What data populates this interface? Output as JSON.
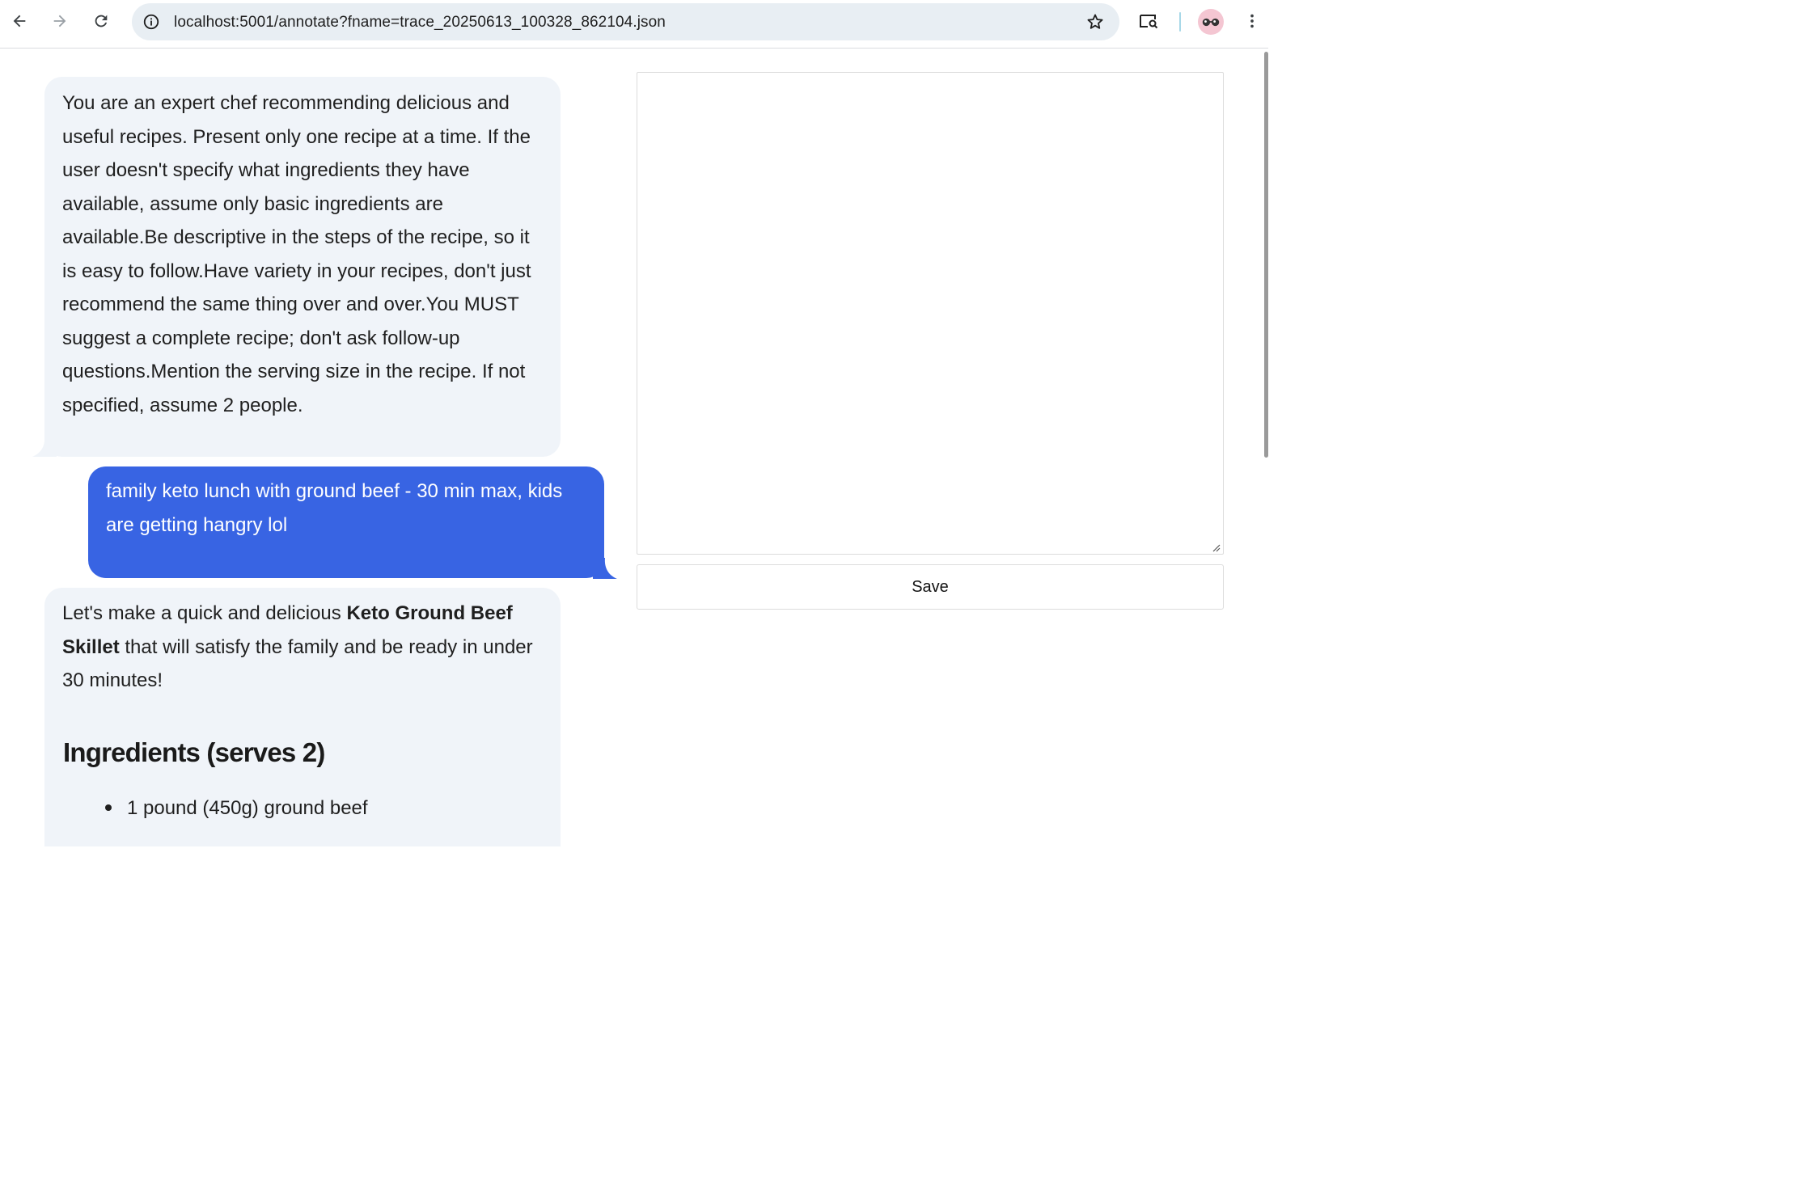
{
  "browser": {
    "url": "localhost:5001/annotate?fname=trace_20250613_100328_862104.json",
    "icons": {
      "back": "arrow-left-icon",
      "forward": "arrow-right-icon",
      "reload": "reload-icon",
      "site_info": "info-icon",
      "bookmark": "star-icon",
      "lens": "search-tab-icon",
      "profile": "avatar-glasses-icon",
      "menu": "kebab-menu-icon"
    }
  },
  "chat": {
    "system_message": "You are an expert chef recommending delicious and useful recipes. Present only one recipe at a time. If the user doesn't specify what ingredients they have available, assume only basic ingredients are available.Be descriptive in the steps of the recipe, so it is easy to follow.Have variety in your recipes, don't just recommend the same thing over and over.You MUST suggest a complete recipe; don't ask follow-up questions.Mention the serving size in the recipe. If not specified, assume 2 people.",
    "user_message": "family keto lunch with ground beef - 30 min max, kids are getting hangry lol",
    "assistant": {
      "intro_before": "Let's make a quick and delicious ",
      "intro_bold": "Keto Ground Beef Skillet",
      "intro_after": " that will satisfy the family and be ready in under 30 minutes!",
      "ingredients_heading": "Ingredients (serves 2)",
      "ingredients": [
        "1 pound (450g) ground beef"
      ]
    }
  },
  "annotation": {
    "notes_value": "",
    "save_label": "Save"
  },
  "colors": {
    "user_bubble": "#3864e3",
    "bubble_bg": "#f0f4f9",
    "omnibox_bg": "#e8eef3"
  }
}
